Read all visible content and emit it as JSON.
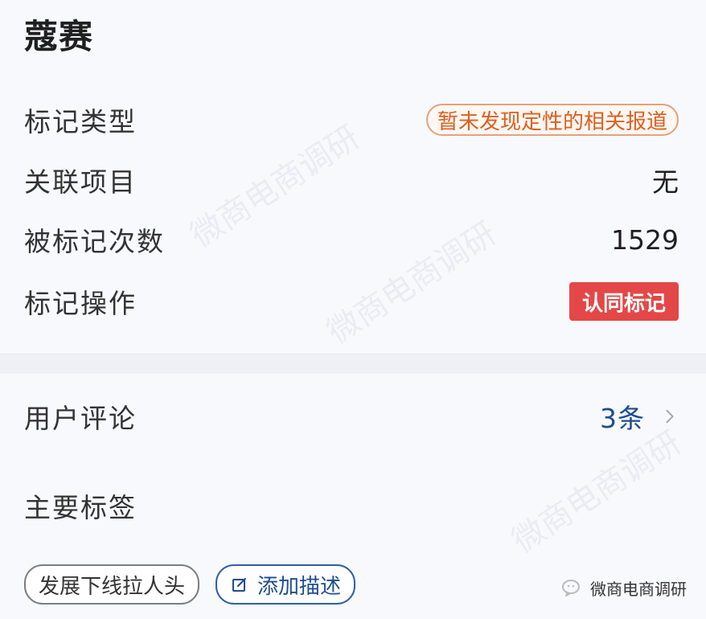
{
  "card": {
    "title": "蔻赛",
    "rows": [
      {
        "label": "标记类型",
        "value": "暂未发现定性的相关报道"
      },
      {
        "label": "关联项目",
        "value": "无"
      },
      {
        "label": "被标记次数",
        "value": "1529"
      },
      {
        "label": "标记操作",
        "value": "认同标记"
      }
    ]
  },
  "section2": {
    "comments_label": "用户评论",
    "comments_value": "3条",
    "tags_label": "主要标签",
    "tags": [
      "发展下线拉人头"
    ],
    "add_tag_label": "添加描述"
  },
  "watermark": {
    "text": "微商电商调研"
  },
  "colors": {
    "accent_orange": "#dd5f21",
    "accent_red": "#e44747",
    "accent_blue": "#1e4c8f"
  }
}
